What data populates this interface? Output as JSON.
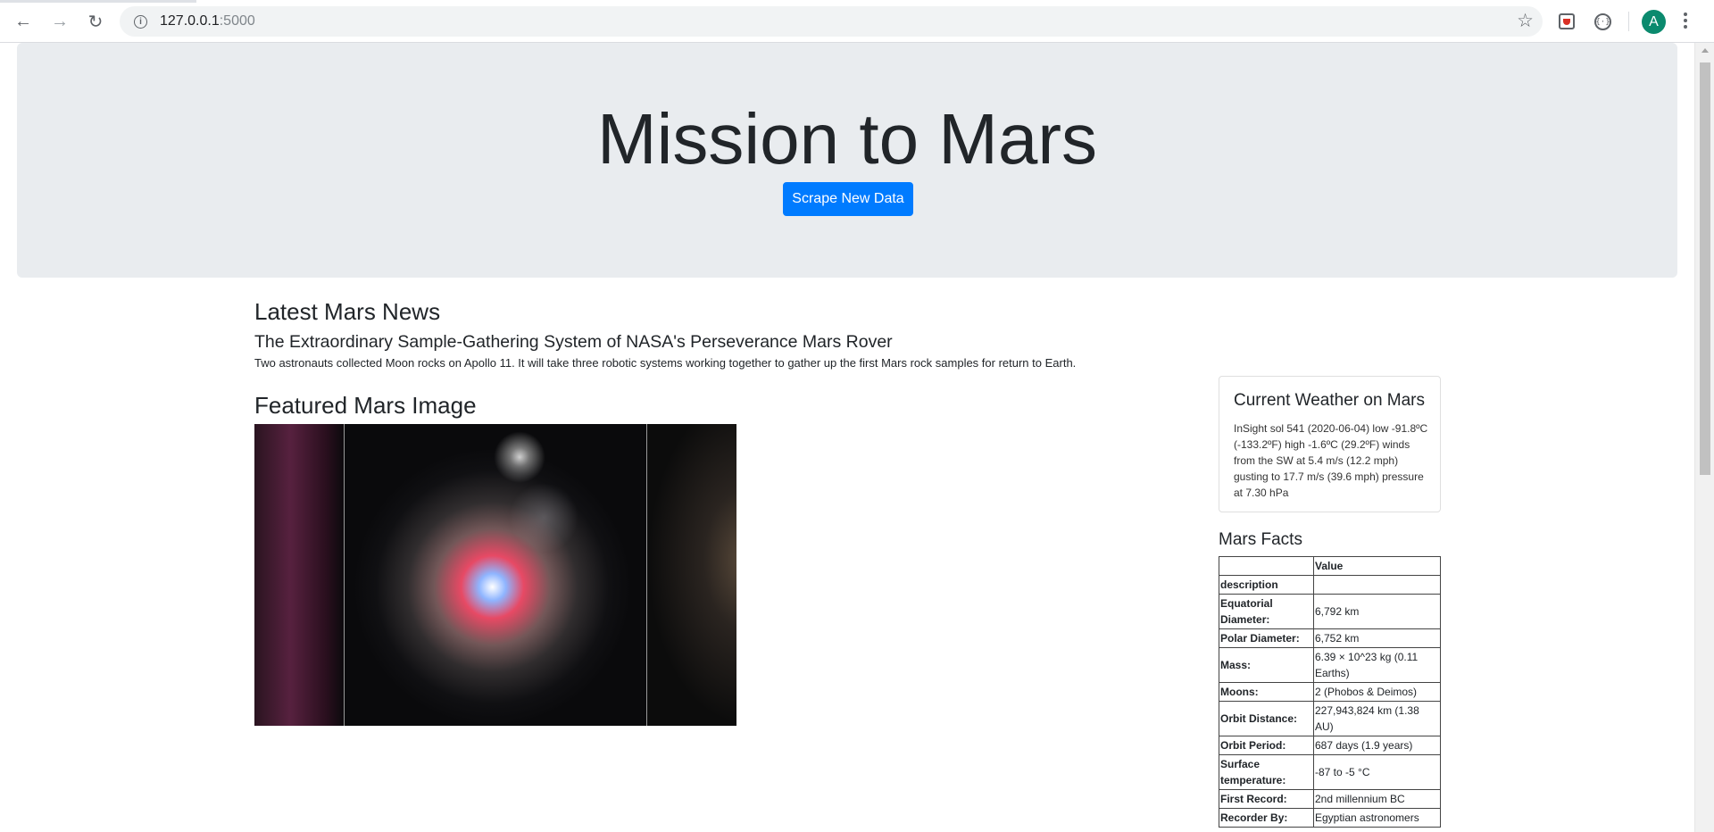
{
  "browser": {
    "url_host": "127.0.0.1",
    "url_port": ":5000",
    "avatar_letter": "A"
  },
  "jumbotron": {
    "title": "Mission to Mars",
    "button_label": "Scrape New Data"
  },
  "news": {
    "heading": "Latest Mars News",
    "title": "The Extraordinary Sample-Gathering System of NASA's Perseverance Mars Rover",
    "paragraph": "Two astronauts collected Moon rocks on Apollo 11. It will take three robotic systems working together to gather up the first Mars rock samples for return to Earth."
  },
  "featured_image": {
    "heading": "Featured Mars Image"
  },
  "weather": {
    "heading": "Current Weather on Mars",
    "text": "InSight sol 541 (2020-06-04) low -91.8ºC (-133.2ºF) high -1.6ºC (29.2ºF) winds from the SW at 5.4 m/s (12.2 mph) gusting to 17.7 m/s (39.6 mph) pressure at 7.30 hPa"
  },
  "facts": {
    "heading": "Mars Facts",
    "col_header": "Value",
    "index_header": "description",
    "rows": [
      {
        "label": "Equatorial Diameter:",
        "value": "6,792 km"
      },
      {
        "label": "Polar Diameter:",
        "value": "6,752 km"
      },
      {
        "label": "Mass:",
        "value": "6.39 × 10^23 kg (0.11 Earths)"
      },
      {
        "label": "Moons:",
        "value": "2 (Phobos & Deimos)"
      },
      {
        "label": "Orbit Distance:",
        "value": "227,943,824 km (1.38 AU)"
      },
      {
        "label": "Orbit Period:",
        "value": "687 days (1.9 years)"
      },
      {
        "label": "Surface temperature:",
        "value": "-87 to -5 °C"
      },
      {
        "label": "First Record:",
        "value": "2nd millennium BC"
      },
      {
        "label": "Recorder By:",
        "value": "Egyptian astronomers"
      }
    ]
  }
}
